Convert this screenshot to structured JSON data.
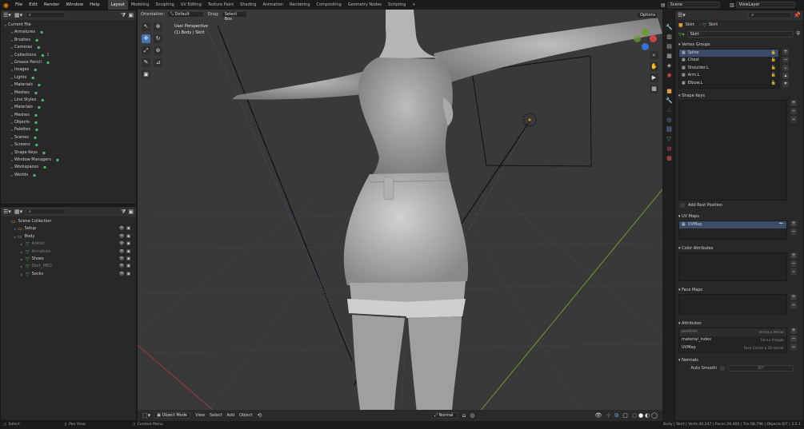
{
  "topbar": {
    "menus": [
      "File",
      "Edit",
      "Render",
      "Window",
      "Help"
    ],
    "workspaces": [
      "Layout",
      "Modeling",
      "Sculpting",
      "UV Editing",
      "Texture Paint",
      "Shading",
      "Animation",
      "Rendering",
      "Compositing",
      "Geometry Nodes",
      "Scripting"
    ],
    "active_workspace": "Layout",
    "add_tab": "+",
    "scene": "Scene",
    "view_layer": "ViewLayer"
  },
  "blend_file": {
    "root": "Current File",
    "items": [
      {
        "label": "Armatures"
      },
      {
        "label": "Brushes"
      },
      {
        "label": "Cameras"
      },
      {
        "label": "Collections",
        "badge": "2"
      },
      {
        "label": "Grease Pencil"
      },
      {
        "label": "Images"
      },
      {
        "label": "Lights"
      },
      {
        "label": "Materials"
      },
      {
        "label": "Meshes"
      },
      {
        "label": "Line Styles"
      },
      {
        "label": "Materials"
      },
      {
        "label": "Meshes"
      },
      {
        "label": "Objects"
      },
      {
        "label": "Palettes"
      },
      {
        "label": "Scenes"
      },
      {
        "label": "Screens"
      },
      {
        "label": "Shape Keys"
      },
      {
        "label": "Window Managers"
      },
      {
        "label": "Workspaces"
      },
      {
        "label": "Worlds"
      }
    ]
  },
  "outliner": {
    "items": [
      {
        "label": "Scene Collection"
      },
      {
        "label": "Setup"
      },
      {
        "label": "Body"
      },
      {
        "label": "Anklet"
      },
      {
        "label": "Armature"
      },
      {
        "label": "Shoes"
      },
      {
        "label": "Skirt_MEG"
      },
      {
        "label": "Socks"
      }
    ]
  },
  "viewport": {
    "orientation_label": "Orientation:",
    "orientation_value": "Default",
    "drag_label": "Drag:",
    "drag_value": "Select Box",
    "options": "Options",
    "view_name": "User Perspective",
    "view_sub": "(1) Body | Skirt",
    "mode": "Object Mode",
    "menu_view": "View",
    "menu_select": "Select",
    "menu_add": "Add",
    "menu_object": "Object",
    "shading": "Normal"
  },
  "properties": {
    "object_name": "Skirt",
    "mesh_name": "Skirt",
    "data_name": "Skirt",
    "vertex_groups_title": "Vertex Groups",
    "vertex_groups": [
      "Spine",
      "Chest",
      "Shoulder.L",
      "Arm.L",
      "Elbow.L"
    ],
    "shape_keys_title": "Shape Keys",
    "add_rest_position": "Add Rest Position",
    "uv_maps_title": "UV Maps",
    "uv_maps": [
      "UVMap"
    ],
    "color_attributes_title": "Color Attributes",
    "face_maps_title": "Face Maps",
    "attributes_title": "Attributes",
    "attributes": [
      {
        "name": "position",
        "domain": "Vertex ▸ Vector"
      },
      {
        "name": "material_index",
        "domain": "Face ▸ Integer"
      },
      {
        "name": "UVMap",
        "domain": "Face Corner ▸ 2D Vector"
      }
    ],
    "normals_title": "Normals",
    "auto_smooth_label": "Auto Smooth",
    "auto_smooth_angle": "30°"
  },
  "statusbar": {
    "select": "Select",
    "pan_view": "Pan View",
    "context_menu": "Context Menu",
    "stats": "Body | Skirt | Verts:30,247 | Faces:29,400 | Tris:58,796 | Objects:0/7 | 3.5.1"
  },
  "colors": {
    "accent": "#4772b3",
    "selection": "#3b4b6a",
    "mesh_green": "#4fb76d",
    "object_orange": "#e39c4a"
  }
}
